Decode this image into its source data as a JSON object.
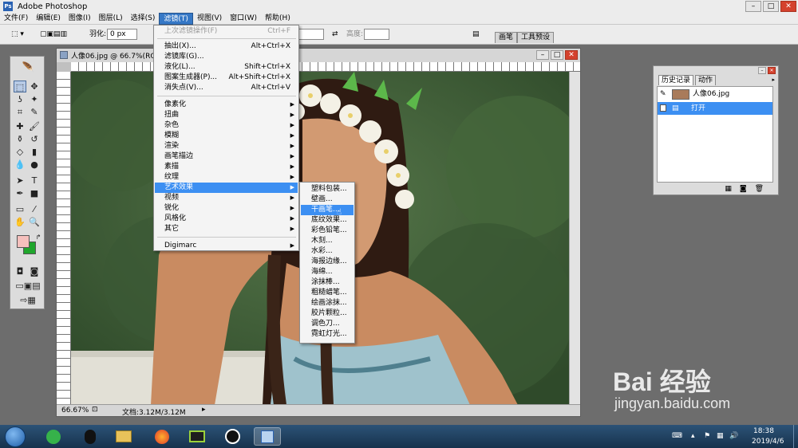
{
  "app": {
    "title": "Adobe Photoshop",
    "logo_text": "Ps"
  },
  "menubar": [
    "文件(F)",
    "编辑(E)",
    "图像(I)",
    "图层(L)",
    "选择(S)",
    "滤镜(T)",
    "视图(V)",
    "窗口(W)",
    "帮助(H)"
  ],
  "options": {
    "feather_label": "羽化:",
    "feather_value": "0 px",
    "height_label": "高度:",
    "tab_brush": "画笔",
    "tab_presets": "工具预设"
  },
  "document": {
    "title": "人像06.jpg @ 66.7%(RGB/8)",
    "zoom": "66.67%",
    "doc_size": "文档:3.12M/3.12M"
  },
  "filter_menu": {
    "items": [
      {
        "label": "上次滤镜操作(F)",
        "shortcut": "Ctrl+F",
        "disabled": true
      },
      {
        "label": "抽出(X)...",
        "shortcut": "Alt+Ctrl+X"
      },
      {
        "label": "滤镜库(G)..."
      },
      {
        "label": "液化(L)...",
        "shortcut": "Shift+Ctrl+X"
      },
      {
        "label": "图案生成器(P)...",
        "shortcut": "Alt+Shift+Ctrl+X"
      },
      {
        "label": "消失点(V)...",
        "shortcut": "Alt+Ctrl+V"
      },
      {
        "label": "像素化",
        "submenu": true
      },
      {
        "label": "扭曲",
        "submenu": true
      },
      {
        "label": "杂色",
        "submenu": true
      },
      {
        "label": "模糊",
        "submenu": true
      },
      {
        "label": "渲染",
        "submenu": true
      },
      {
        "label": "画笔描边",
        "submenu": true
      },
      {
        "label": "素描",
        "submenu": true
      },
      {
        "label": "纹理",
        "submenu": true
      },
      {
        "label": "艺术效果",
        "submenu": true,
        "highlighted": true
      },
      {
        "label": "视频",
        "submenu": true
      },
      {
        "label": "锐化",
        "submenu": true
      },
      {
        "label": "风格化",
        "submenu": true
      },
      {
        "label": "其它",
        "submenu": true
      },
      {
        "label": "Digimarc",
        "submenu": true
      }
    ]
  },
  "artistic_submenu": [
    "塑料包装...",
    "壁画...",
    "干画笔...",
    "底纹效果...",
    "彩色铅笔...",
    "木刻...",
    "水彩...",
    "海报边缘...",
    "海绵...",
    "涂抹棒...",
    "粗糙蜡笔...",
    "绘画涂抹...",
    "胶片颗粒...",
    "调色刀...",
    "霓虹灯光..."
  ],
  "artistic_highlighted_index": 2,
  "history_panel": {
    "tabs": [
      "历史记录",
      "动作"
    ],
    "snapshot": "人像06.jpg",
    "step": "打开"
  },
  "taskbar": {
    "time": "18:38",
    "date": "2019/4/6"
  },
  "watermark": {
    "logo": "Bai 经验",
    "url": "jingyan.baidu.com"
  },
  "colors": {
    "foreground": "#f5c0bd",
    "background": "#1fa62c",
    "highlight": "#3c8ff2"
  }
}
